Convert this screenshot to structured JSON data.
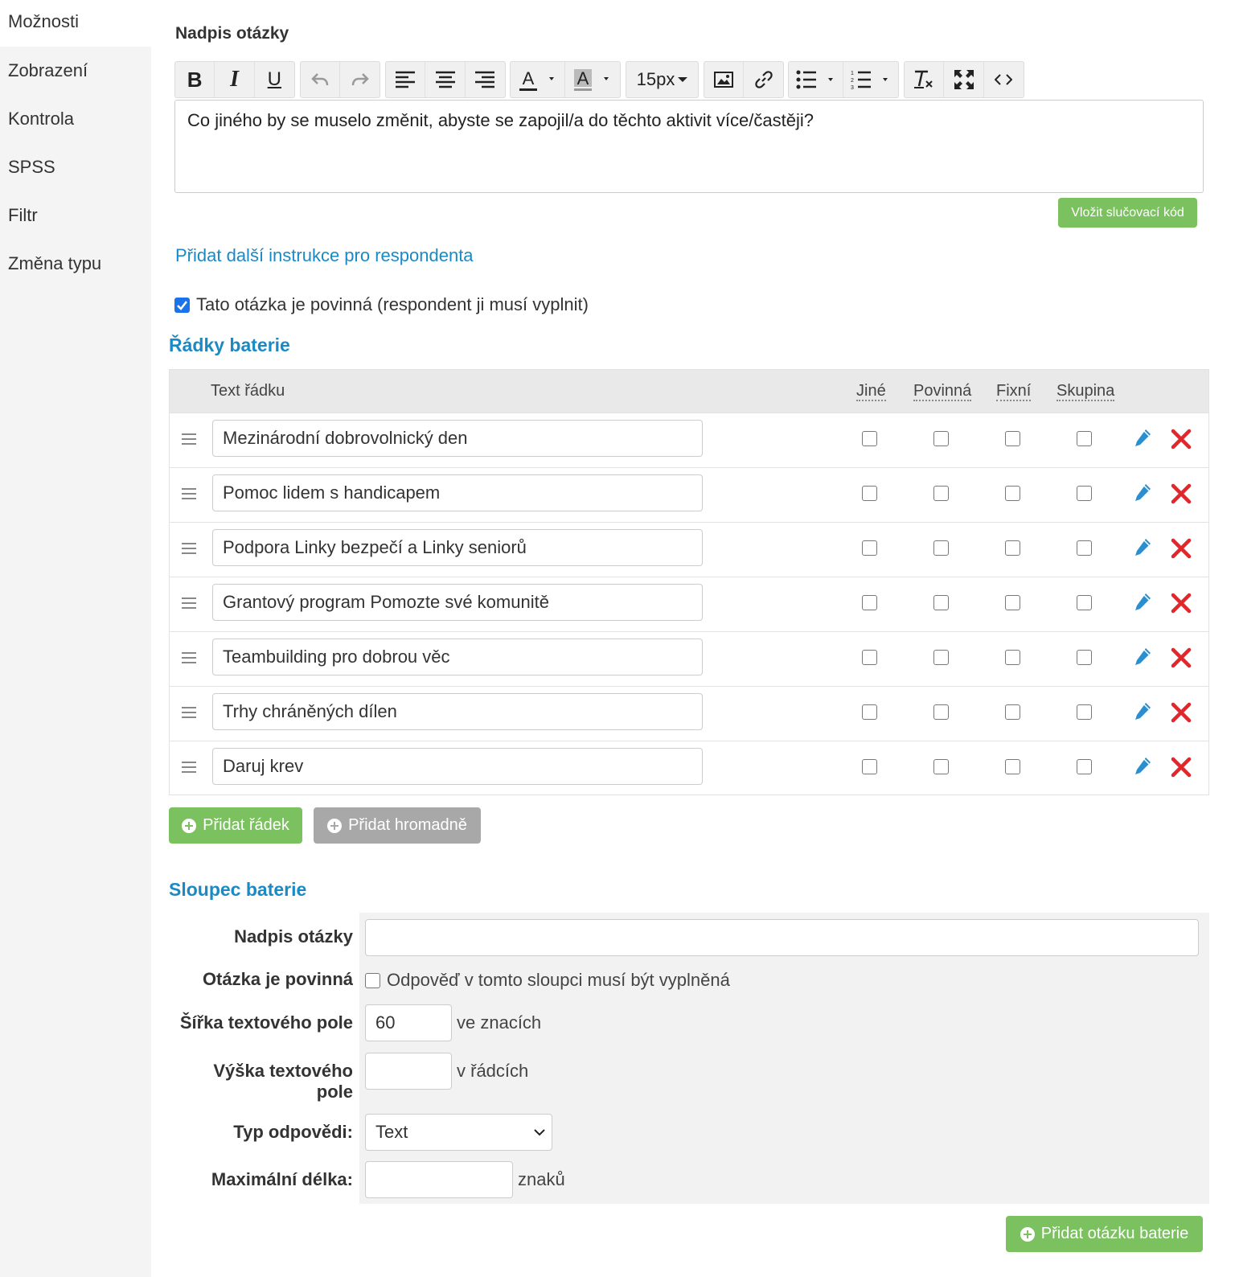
{
  "sidebar": {
    "items": [
      {
        "label": "Možnosti"
      },
      {
        "label": "Zobrazení"
      },
      {
        "label": "Kontrola"
      },
      {
        "label": "SPSS"
      },
      {
        "label": "Filtr"
      },
      {
        "label": "Změna typu"
      }
    ]
  },
  "question": {
    "heading": "Nadpis otázky",
    "font_size": "15px",
    "text": "Co jiného by se muselo změnit, abyste se zapojil/a do těchto aktivit více/častěji?",
    "merge_button": "Vložit slučovací kód",
    "add_instructions_link": "Přidat další instrukce pro respondenta",
    "required_checked": true,
    "required_label": "Tato otázka je povinná (respondent ji musí vyplnit)"
  },
  "rows_section": {
    "title": "Řádky baterie",
    "columns": {
      "text": "Text řádku",
      "other": "Jiné",
      "required": "Povinná",
      "fixed": "Fixní",
      "group": "Skupina"
    },
    "rows": [
      {
        "text": "Mezinárodní dobrovolnický den"
      },
      {
        "text": "Pomoc lidem s handicapem"
      },
      {
        "text": "Podpora Linky bezpečí a Linky seniorů"
      },
      {
        "text": "Grantový program Pomozte své komunitě"
      },
      {
        "text": "Teambuilding pro dobrou věc"
      },
      {
        "text": "Trhy chráněných dílen"
      },
      {
        "text": "Daruj krev"
      }
    ],
    "add_row_button": "Přidat řádek",
    "add_bulk_button": "Přidat hromadně"
  },
  "column_section": {
    "title": "Sloupec baterie",
    "heading_label": "Nadpis otázky",
    "heading_value": "",
    "required_label": "Otázka je povinná",
    "required_checkbox_label": "Odpověď v tomto sloupci musí být vyplněná",
    "width_label": "Šířka textového pole",
    "width_value": "60",
    "width_suffix": "ve znacích",
    "height_label_line1": "Výška textového",
    "height_label_line2": "pole",
    "height_value": "",
    "height_suffix": "v řádcích",
    "answer_type_label": "Typ odpovědi:",
    "answer_type_value": "Text",
    "max_length_label": "Maximální délka:",
    "max_length_value": "",
    "max_length_suffix": "znaků",
    "add_question_button": "Přidat otázku baterie"
  },
  "colors": {
    "accent_blue": "#1a8ac4",
    "green": "#7cc160",
    "delete_red": "#e0272c",
    "edit_blue": "#2a8fd0"
  }
}
